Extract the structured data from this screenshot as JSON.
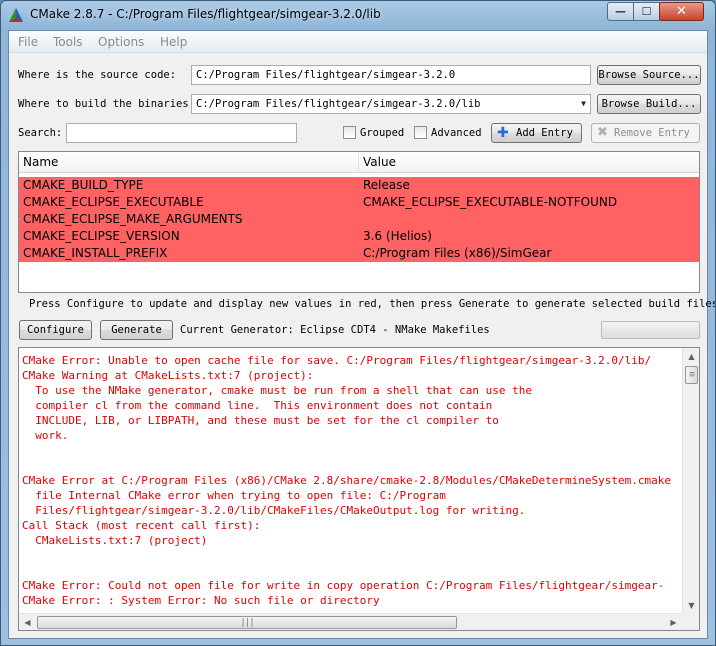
{
  "window": {
    "title": "CMake 2.8.7 - C:/Program Files/flightgear/simgear-3.2.0/lib",
    "controls": {
      "minimize": "—",
      "maximize": "☐",
      "close": "✕"
    }
  },
  "menu": [
    "File",
    "Tools",
    "Options",
    "Help"
  ],
  "source": {
    "label": "Where is the source code:",
    "value": "C:/Program Files/flightgear/simgear-3.2.0",
    "button": "Browse Source..."
  },
  "build": {
    "label": "Where to build the binaries:",
    "value": "C:/Program Files/flightgear/simgear-3.2.0/lib",
    "button": "Browse Build..."
  },
  "search": {
    "label": "Search:",
    "value": "",
    "grouped_label": "Grouped",
    "grouped_checked": false,
    "advanced_label": "Advanced",
    "advanced_checked": false,
    "add_entry": "Add Entry",
    "remove_entry": "Remove Entry"
  },
  "table": {
    "columns": [
      "Name",
      "Value"
    ],
    "row_color": "#ff6262",
    "rows": [
      {
        "name": "CMAKE_BUILD_TYPE",
        "value": "Release"
      },
      {
        "name": "CMAKE_ECLIPSE_EXECUTABLE",
        "value": "CMAKE_ECLIPSE_EXECUTABLE-NOTFOUND"
      },
      {
        "name": "CMAKE_ECLIPSE_MAKE_ARGUMENTS",
        "value": ""
      },
      {
        "name": "CMAKE_ECLIPSE_VERSION",
        "value": "3.6 (Helios)"
      },
      {
        "name": "CMAKE_INSTALL_PREFIX",
        "value": "C:/Program Files (x86)/SimGear"
      }
    ]
  },
  "hint": "Press Configure to update and display new values in red, then press Generate to generate selected build files.",
  "actions": {
    "configure": "Configure",
    "generate": "Generate",
    "generator": "Current Generator: Eclipse CDT4 - NMake Makefiles"
  },
  "output": {
    "color": "#e00000",
    "lines": [
      "CMake Error: Unable to open cache file for save. C:/Program Files/flightgear/simgear-3.2.0/lib/",
      "CMake Warning at CMakeLists.txt:7 (project):",
      "  To use the NMake generator, cmake must be run from a shell that can use the",
      "  compiler cl from the command line.  This environment does not contain",
      "  INCLUDE, LIB, or LIBPATH, and these must be set for the cl compiler to",
      "  work.",
      "",
      "",
      "CMake Error at C:/Program Files (x86)/CMake 2.8/share/cmake-2.8/Modules/CMakeDetermineSystem.cmake",
      "  file Internal CMake error when trying to open file: C:/Program",
      "  Files/flightgear/simgear-3.2.0/lib/CMakeFiles/CMakeOutput.log for writing.",
      "Call Stack (most recent call first):",
      "  CMakeLists.txt:7 (project)",
      "",
      "",
      "CMake Error: Could not open file for write in copy operation C:/Program Files/flightgear/simgear-",
      "CMake Error: : System Error: No such file or directory"
    ]
  }
}
